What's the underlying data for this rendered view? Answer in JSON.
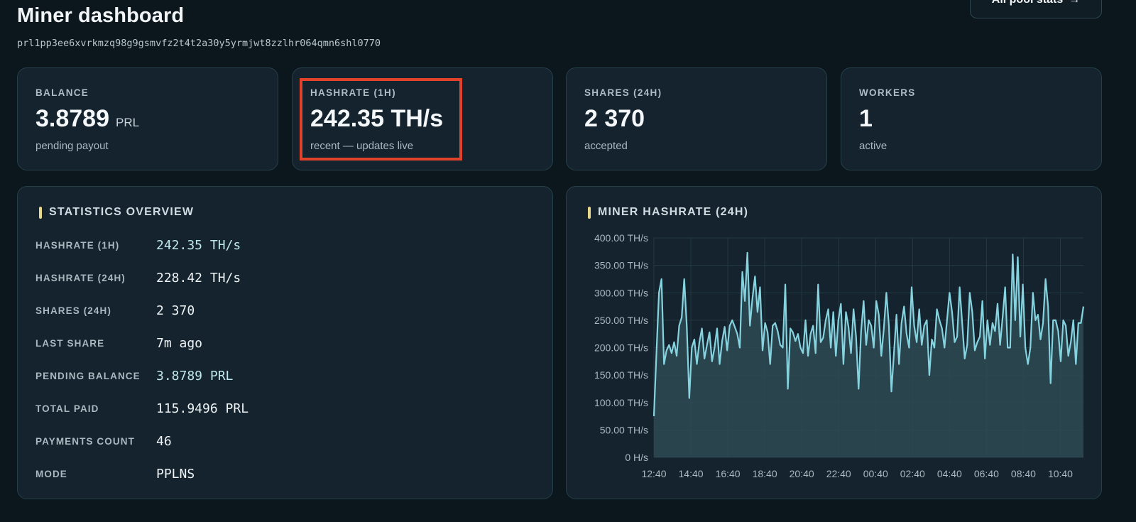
{
  "header": {
    "title": "Miner dashboard",
    "address": "prl1pp3ee6xvrkmzq98g9gsmvfz2t4t2a30y5yrmjwt8zzlhr064qmn6shl0770",
    "pool_button_label": "All pool stats",
    "pool_button_icon": "arrow-right-icon"
  },
  "stat_cards": [
    {
      "label": "BALANCE",
      "value": "3.8789",
      "unit": "PRL",
      "sub": "pending payout"
    },
    {
      "label": "HASHRATE (1H)",
      "value": "242.35 TH/s",
      "unit": "",
      "sub": "recent — updates live"
    },
    {
      "label": "SHARES (24H)",
      "value": "2 370",
      "unit": "",
      "sub": "accepted"
    },
    {
      "label": "WORKERS",
      "value": "1",
      "unit": "",
      "sub": "active"
    }
  ],
  "statistics_overview": {
    "title": "STATISTICS OVERVIEW",
    "rows": [
      {
        "key": "HASHRATE (1H)",
        "value": "242.35 TH/s"
      },
      {
        "key": "HASHRATE (24H)",
        "value": "228.42 TH/s"
      },
      {
        "key": "SHARES (24H)",
        "value": "2 370"
      },
      {
        "key": "LAST SHARE",
        "value": "7m ago"
      },
      {
        "key": "PENDING BALANCE",
        "value": "3.8789 PRL"
      },
      {
        "key": "TOTAL PAID",
        "value": "115.9496 PRL"
      },
      {
        "key": "PAYMENTS COUNT",
        "value": "46"
      },
      {
        "key": "MODE",
        "value": "PPLNS"
      }
    ]
  },
  "hashrate_chart": {
    "title": "MINER HASHRATE (24H)"
  },
  "colors": {
    "background": "#0c161d",
    "card": "#14232d",
    "card_border": "#26404a",
    "accent_bar": "#e9d98c",
    "line": "#86d3e0",
    "area": "#2e4a55",
    "highlight": "#e0432a"
  },
  "chart_data": {
    "type": "area",
    "title": "MINER HASHRATE (24H)",
    "xlabel": "",
    "ylabel": "",
    "x_ticks": [
      "12:40",
      "14:40",
      "16:40",
      "18:40",
      "20:40",
      "22:40",
      "00:40",
      "02:40",
      "04:40",
      "06:40",
      "08:40",
      "10:40"
    ],
    "y_ticks": [
      "0 H/s",
      "50.00 TH/s",
      "100.00 TH/s",
      "150.00 TH/s",
      "200.00 TH/s",
      "250.00 TH/s",
      "300.00 TH/s",
      "350.00 TH/s",
      "400.00 TH/s"
    ],
    "ylim": [
      0,
      400
    ],
    "unit": "TH/s",
    "grid": true,
    "legend": "none",
    "x_start": "12:40",
    "x_end": "11:55",
    "series": [
      {
        "values": [
          75,
          190,
          300,
          325,
          170,
          195,
          205,
          190,
          210,
          185,
          240,
          255,
          325,
          240,
          108,
          200,
          215,
          170,
          210,
          235,
          180,
          205,
          228,
          175,
          200,
          235,
          170,
          212,
          238,
          195,
          240,
          250,
          238,
          225,
          200,
          338,
          285,
          373,
          240,
          290,
          330,
          265,
          310,
          195,
          245,
          228,
          170,
          240,
          245,
          230,
          205,
          200,
          315,
          125,
          235,
          228,
          212,
          225,
          200,
          190,
          250,
          185,
          225,
          240,
          190,
          315,
          210,
          218,
          250,
          270,
          200,
          265,
          185,
          250,
          280,
          170,
          265,
          238,
          190,
          270,
          220,
          125,
          230,
          285,
          205,
          250,
          240,
          200,
          285,
          260,
          185,
          235,
          300,
          240,
          120,
          190,
          260,
          170,
          245,
          275,
          225,
          200,
          310,
          240,
          210,
          270,
          205,
          240,
          250,
          150,
          215,
          200,
          270,
          250,
          235,
          200,
          250,
          300,
          265,
          210,
          220,
          310,
          245,
          180,
          205,
          300,
          265,
          195,
          210,
          220,
          285,
          180,
          250,
          205,
          245,
          230,
          280,
          205,
          255,
          310,
          200,
          200,
          370,
          250,
          365,
          220,
          315,
          200,
          170,
          200,
          300,
          250,
          260,
          215,
          245,
          325,
          275,
          135,
          250,
          250,
          230,
          175,
          250,
          240,
          185,
          210,
          250,
          170,
          245,
          245,
          275
        ]
      }
    ]
  }
}
